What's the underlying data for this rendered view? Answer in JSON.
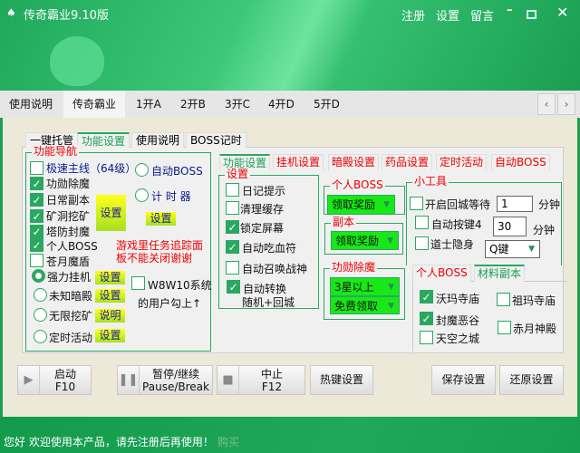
{
  "window": {
    "title": "传奇霸业9.10版",
    "links": [
      "注册",
      "设置",
      "留言"
    ]
  },
  "main_tabs": [
    "使用说明",
    "传奇霸业",
    "1开A",
    "2开B",
    "3开C",
    "4开D",
    "5开D"
  ],
  "inner_tabs": [
    "一键托管",
    "功能设置",
    "使用说明",
    "BOSS记时"
  ],
  "nav": {
    "title": "功能导航",
    "checks": [
      {
        "label": "极速主线（64级）",
        "checked": false
      },
      {
        "label": "功勋除魔",
        "checked": true
      },
      {
        "label": "日常副本",
        "checked": true
      },
      {
        "label": "矿洞挖矿",
        "checked": true
      },
      {
        "label": "塔防封魔",
        "checked": true
      },
      {
        "label": "个人BOSS",
        "checked": true
      },
      {
        "label": "苍月魔盾",
        "checked": false
      }
    ],
    "setup_big": "设置",
    "auto_boss": "自动BOSS",
    "timer": "计 时 器",
    "timer_setup": "设置",
    "notice": [
      "游戏里任务追踪面",
      "板不能关闭谢谢"
    ],
    "modes": [
      {
        "label": "强力挂机",
        "btn": "设置",
        "selected": true
      },
      {
        "label": "未知暗殿",
        "btn": "设置",
        "selected": false
      },
      {
        "label": "无限挖矿",
        "btn": "说明",
        "selected": false
      },
      {
        "label": "定时活动",
        "btn": "设置",
        "selected": false
      }
    ],
    "w8": {
      "label": "W8W10系统",
      "note": "的用户勾上↑",
      "checked": false
    }
  },
  "sub_tabs": [
    "功能设置",
    "挂机设置",
    "暗殿设置",
    "药品设置",
    "定时活动",
    "自动BOSS"
  ],
  "settings": {
    "title": "设置",
    "items": [
      {
        "label": "日记提示",
        "checked": false
      },
      {
        "label": "清理缓存",
        "checked": false
      },
      {
        "label": "锁定屏幕",
        "checked": true
      },
      {
        "label": "自动吃血符",
        "checked": true
      },
      {
        "label": "自动召唤战神",
        "checked": false
      },
      {
        "label": "自动转换",
        "checked": true
      }
    ],
    "extra": "随机+回城"
  },
  "personal_boss": {
    "title": "个人BOSS",
    "value": "领取奖励"
  },
  "dungeon": {
    "title": "副本",
    "value": "领取奖励"
  },
  "merit": {
    "title": "功勋除魔",
    "value1": "3星以上",
    "value2": "免费领取"
  },
  "tools": {
    "title": "小工具",
    "return_wait": "开启回城等待",
    "return_value": "1",
    "unit1": "分钟",
    "auto_key": "自动按键4",
    "key_value": "30",
    "unit2": "分钟",
    "stealth": "道士隐身",
    "key_select": "Q键"
  },
  "bottom_tabs": [
    "个人BOSS",
    "材料副本"
  ],
  "materials": [
    {
      "label": "沃玛寺庙",
      "checked": true
    },
    {
      "label": "祖玛寺庙",
      "checked": false
    },
    {
      "label": "封魔恶谷",
      "checked": true
    },
    {
      "label": "赤月神殿",
      "checked": false
    },
    {
      "label": "天空之城",
      "checked": false
    }
  ],
  "buttons": {
    "start": [
      "启动",
      "F10"
    ],
    "pause": [
      "暂停/继续",
      "Pause/Break"
    ],
    "stop": [
      "中止",
      "F12"
    ],
    "hotkey": "热键设置",
    "save": "保存设置",
    "restore": "还原设置"
  },
  "status": {
    "text": "您好 欢迎使用本产品，请先注册后再使用！",
    "buy": "购买"
  }
}
